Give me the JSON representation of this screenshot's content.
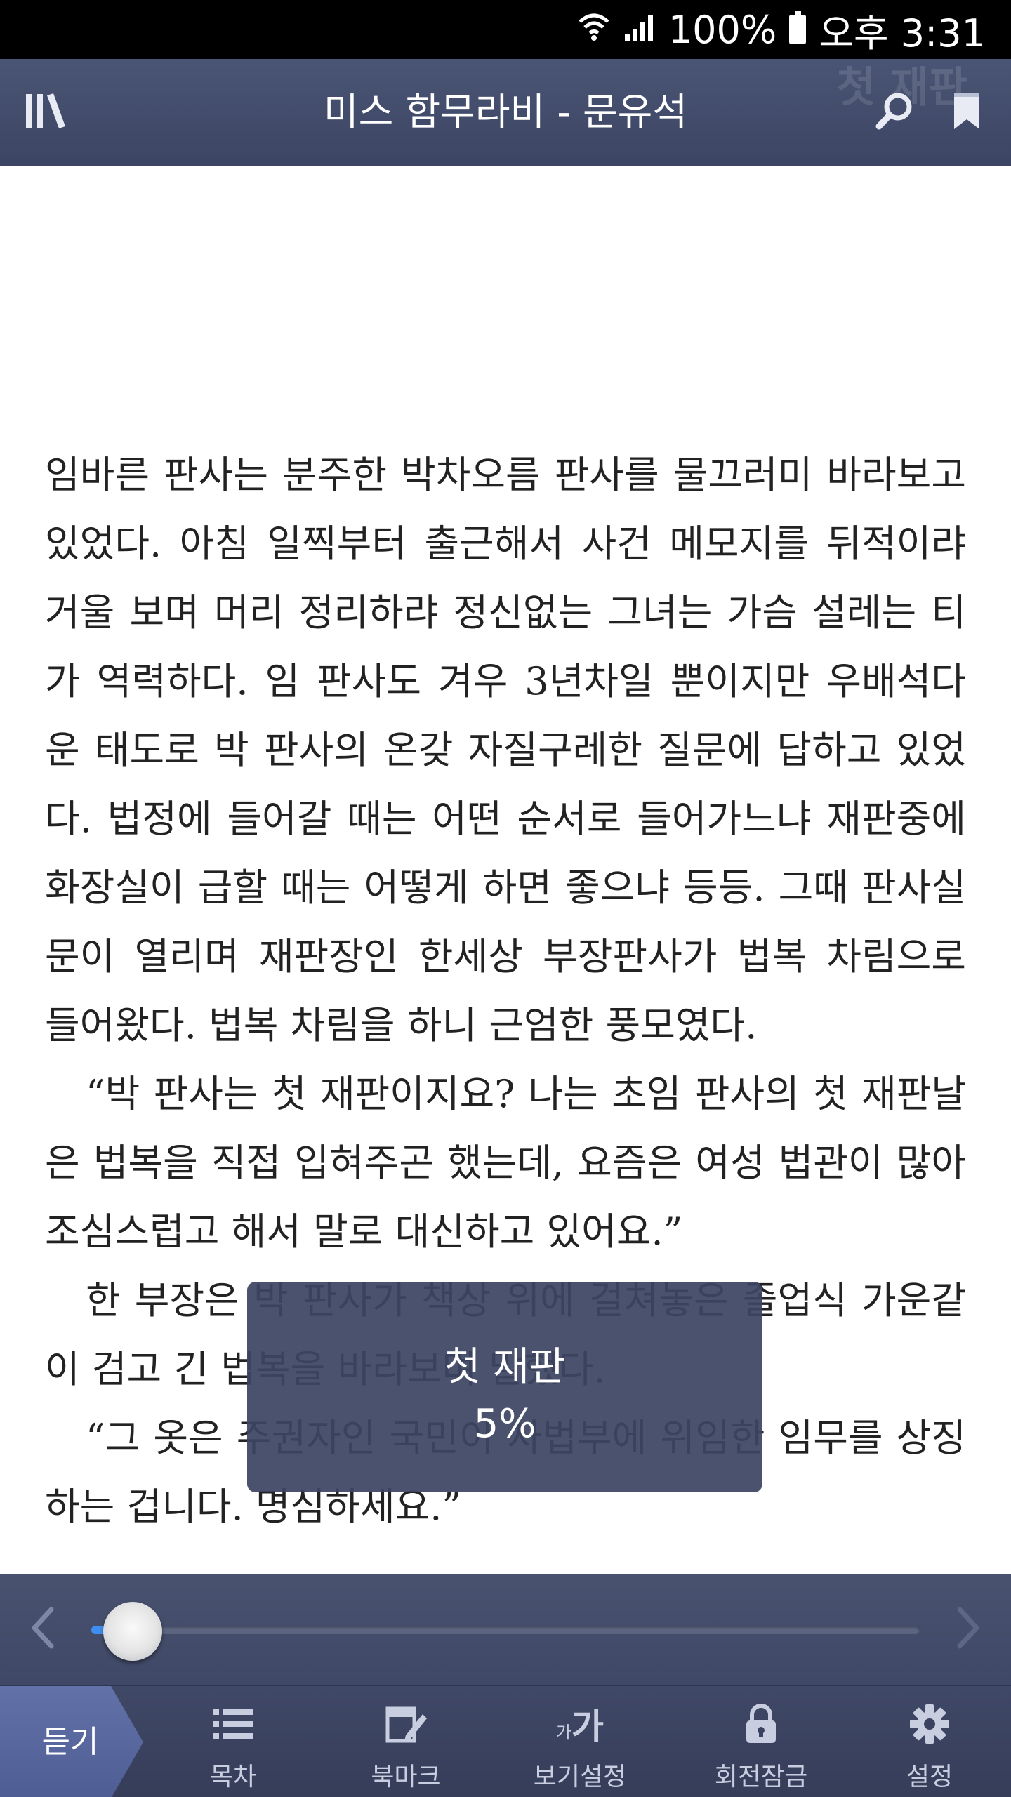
{
  "status_bar": {
    "battery": "100%",
    "time": "오후 3:31"
  },
  "header": {
    "title": "미스 함무라비 - 문유석",
    "ghost_text": "첫 재판"
  },
  "content": {
    "paragraphs": [
      "임바른 판사는 분주한 박차오름 판사를 물끄러미 바라보고 있었다. 아침 일찍부터 출근해서 사건 메모지를 뒤적이랴 거울 보며 머리 정리하랴 정신없는 그녀는 가슴 설레는 티가 역력하다. 임 판사도 겨우 3년차일 뿐이지만 우배석다운 태도로 박 판사의 온갖 자질구레한 질문에 답하고 있었다. 법정에 들어갈 때는 어떤 순서로 들어가느냐 재판중에 화장실이 급할 때는 어떻게 하면 좋으냐 등등. 그때 판사실 문이 열리며 재판장인 한세상 부장판사가 법복 차림으로 들어왔다. 법복 차림을 하니 근엄한 풍모였다.",
      "“박 판사는 첫 재판이지요? 나는 초임 판사의 첫 재판날은 법복을 직접 입혀주곤 했는데, 요즘은 여성 법관이 많아 조심스럽고 해서 말로 대신하고 있어요.”",
      "한 부장은 박 판사가 책상 위에 걸쳐놓은 졸업식 가운같이 검고 긴 법복을 바라보며 말했다.",
      "“그 옷은 주권자인 국민이 사법부에 위임한 임무를 상징하는 겁니다. 명심하세요.”"
    ]
  },
  "toast": {
    "title": "첫 재판",
    "percent": "5%"
  },
  "progress": {
    "fraction": 0.05
  },
  "bottom_bar": {
    "listen": "듣기",
    "toc": "목차",
    "bookmark": "북마크",
    "view_settings": "보기설정",
    "rotation_lock": "회전잠금",
    "settings": "설정",
    "view_icon_small": "가",
    "view_icon_large": "가"
  },
  "colors": {
    "header_bg": "#404a68",
    "accent_blue": "#3f8ff3",
    "listen_tab": "#5868a0"
  }
}
